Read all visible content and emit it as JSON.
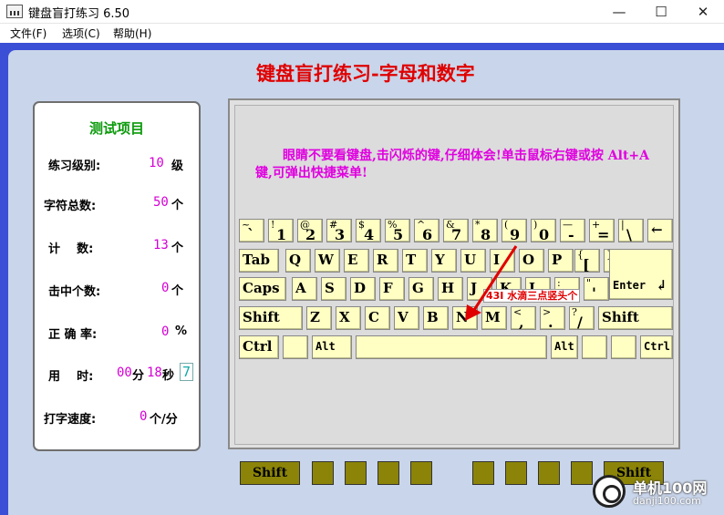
{
  "window": {
    "title": "键盘盲打练习 6.50",
    "minimize_glyph": "—",
    "maximize_glyph": "☐",
    "close_glyph": "✕"
  },
  "menu": [
    "文件(F)",
    "选项(C)",
    "帮助(H)"
  ],
  "main_title": "键盘盲打练习-字母和数字",
  "stats": {
    "heading": "测试项目",
    "level_label": "练习级别:",
    "level_value": "10",
    "level_unit": "级",
    "total_label": "字符总数:",
    "total_value": "50",
    "total_unit": "个",
    "count_label": "计    数:",
    "count_value": "13",
    "count_unit": "个",
    "hits_label": "击中个数:",
    "hits_value": "0",
    "hits_unit": "个",
    "accuracy_label": "正 确 率:",
    "accuracy_value": "0",
    "accuracy_unit": "%",
    "time_label": "用    时:",
    "time_min": "00",
    "time_min_unit": "分",
    "time_sec": "18",
    "time_sec_unit": "秒",
    "time_box": "7",
    "speed_label": "打字速度:",
    "speed_value": "0",
    "speed_unit": "个/分"
  },
  "hint": "眼睛不要看键盘,击闪烁的键,仔细体会!单击鼠标右键或按 Alt+A 键,可弹出快捷菜单!",
  "tooltip": "43I 水滴三点竖头个",
  "keys": {
    "row1": [
      [
        "~",
        "`"
      ],
      [
        "!",
        "1"
      ],
      [
        "@",
        "2"
      ],
      [
        "#",
        "3"
      ],
      [
        "$",
        "4"
      ],
      [
        "%",
        "5"
      ],
      [
        "^",
        "6"
      ],
      [
        "&",
        "7"
      ],
      [
        "*",
        "8"
      ],
      [
        "(",
        "9"
      ],
      [
        ")",
        "0"
      ],
      [
        "—",
        "-"
      ],
      [
        "+",
        "="
      ],
      [
        "|",
        "\\"
      ]
    ],
    "backspace": "←",
    "tab": "Tab",
    "row2": [
      "Q",
      "W",
      "E",
      "R",
      "T",
      "Y",
      "U",
      "I",
      "O",
      "P"
    ],
    "row2_brackets": [
      [
        "{",
        "["
      ],
      [
        "}",
        "]"
      ]
    ],
    "enter": "Enter",
    "enter_arrow": "↲",
    "caps": "Caps",
    "row3": [
      "A",
      "S",
      "D",
      "F",
      "G",
      "H",
      "J",
      "K",
      "L"
    ],
    "row3_punct": [
      [
        ":",
        ";"
      ],
      [
        "\"",
        "'"
      ]
    ],
    "shift": "Shift",
    "row4": [
      "Z",
      "X",
      "C",
      "V",
      "B",
      "N",
      "M"
    ],
    "row4_punct": [
      [
        "<",
        ","
      ],
      [
        ">",
        "."
      ],
      [
        "?",
        "/"
      ]
    ],
    "ctrl": "Ctrl",
    "alt": "Alt"
  },
  "fingers": {
    "left_shift": "Shift",
    "right_shift": "Shift"
  },
  "watermark": {
    "name": "单机100网",
    "domain": "danji100.com"
  }
}
